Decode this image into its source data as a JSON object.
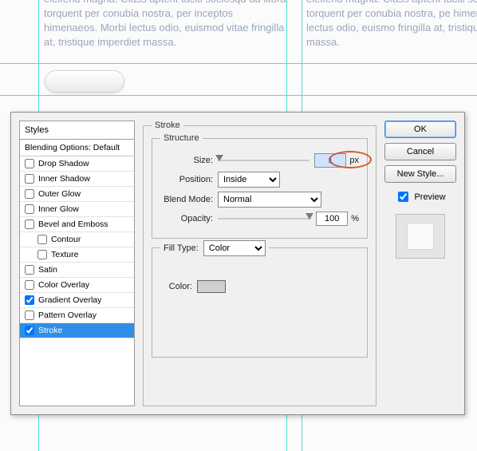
{
  "background": {
    "lorem": "eleifend magna. Class aptent taciti sociosqu ad litora torquent per conubia nostra, per inceptos himenaeos. Morbi lectus odio, euismod vitae fringilla at, tristique imperdiet massa.",
    "lorem2": "eleifend magna. Class aptent taciti sociosqu ad litora torquent per conubia nostra, pe himenaeos. Morbi lectus odio, euismo fringilla at, tristique imperdiet massa."
  },
  "dialog": {
    "styles_header": "Styles",
    "blending_label": "Blending Options: Default",
    "items": [
      {
        "label": "Drop Shadow",
        "checked": false
      },
      {
        "label": "Inner Shadow",
        "checked": false
      },
      {
        "label": "Outer Glow",
        "checked": false
      },
      {
        "label": "Inner Glow",
        "checked": false
      },
      {
        "label": "Bevel and Emboss",
        "checked": false
      },
      {
        "label": "Contour",
        "checked": false,
        "sub": true
      },
      {
        "label": "Texture",
        "checked": false,
        "sub": true
      },
      {
        "label": "Satin",
        "checked": false
      },
      {
        "label": "Color Overlay",
        "checked": false
      },
      {
        "label": "Gradient Overlay",
        "checked": true
      },
      {
        "label": "Pattern Overlay",
        "checked": false
      },
      {
        "label": "Stroke",
        "checked": true,
        "selected": true
      }
    ],
    "stroke": {
      "legend_outer": "Stroke",
      "legend_structure": "Structure",
      "size_label": "Size:",
      "size_value": "1",
      "px": "px",
      "position_label": "Position:",
      "position_value": "Inside",
      "blend_label": "Blend Mode:",
      "blend_value": "Normal",
      "opacity_label": "Opacity:",
      "opacity_value": "100",
      "percent": "%",
      "filltype_label": "Fill Type:",
      "filltype_value": "Color",
      "color_label": "Color:"
    },
    "buttons": {
      "ok": "OK",
      "cancel": "Cancel",
      "new_style": "New Style...",
      "preview": "Preview"
    }
  }
}
